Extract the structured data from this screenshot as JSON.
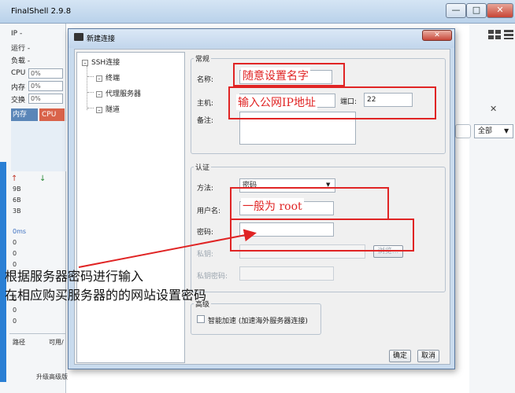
{
  "app": {
    "title": "FinalShell 2.9.8",
    "window_controls": {
      "minimize": "—",
      "maximize": "□",
      "close": "✕"
    }
  },
  "left_panel": {
    "ip_label": "IP -",
    "running_label": "运行 -",
    "load_label": "负载 -",
    "cpu_label": "CPU",
    "cpu_value": "0%",
    "mem_label": "内存",
    "mem_value": "0%",
    "swap_label": "交换",
    "swap_value": "0%",
    "tabs": [
      "内存",
      "CPU"
    ],
    "net_up_icon": "arrow-up-icon",
    "net_down_icon": "arrow-down-icon",
    "net_levels": [
      "9B",
      "6B",
      "3B"
    ],
    "latency_label": "0ms",
    "latency_values": [
      "0",
      "0",
      "0"
    ],
    "lower_values": [
      "0",
      "0",
      "0"
    ],
    "bottom_tabs": [
      "路径",
      "可用/"
    ],
    "upgrade_label": "升级高级版"
  },
  "right_panel": {
    "filter_select": "全部",
    "close_glyph": "✕"
  },
  "dialog": {
    "title": "新建连接",
    "close_glyph": "✕",
    "tree": {
      "root": "SSH连接",
      "children": [
        "终端",
        "代理服务器",
        "隧道"
      ]
    },
    "general": {
      "legend": "常规",
      "name_label": "名称:",
      "host_label": "主机:",
      "port_label": "端口:",
      "port_value": "22",
      "note_label": "备注:"
    },
    "auth": {
      "legend": "认证",
      "method_label": "方法:",
      "method_value": "密码",
      "username_label": "用户名:",
      "password_label": "密码:",
      "private_key_label": "私钥:",
      "browse_label": "浏览...",
      "key_password_label": "私钥密码:"
    },
    "advanced": {
      "legend": "高级",
      "smart_accel_label": "智能加速 (加速海外服务器连接)"
    },
    "ok_label": "确定",
    "cancel_label": "取消"
  },
  "annotations": {
    "name_hint": "随意设置名字",
    "host_hint": "输入公网IP地址",
    "user_hint": "一般为 root",
    "caption_line1": "根据服务器密码进行输入",
    "caption_line2": "在相应购买服务器的的网站设置密码",
    "color": "#e02424"
  }
}
